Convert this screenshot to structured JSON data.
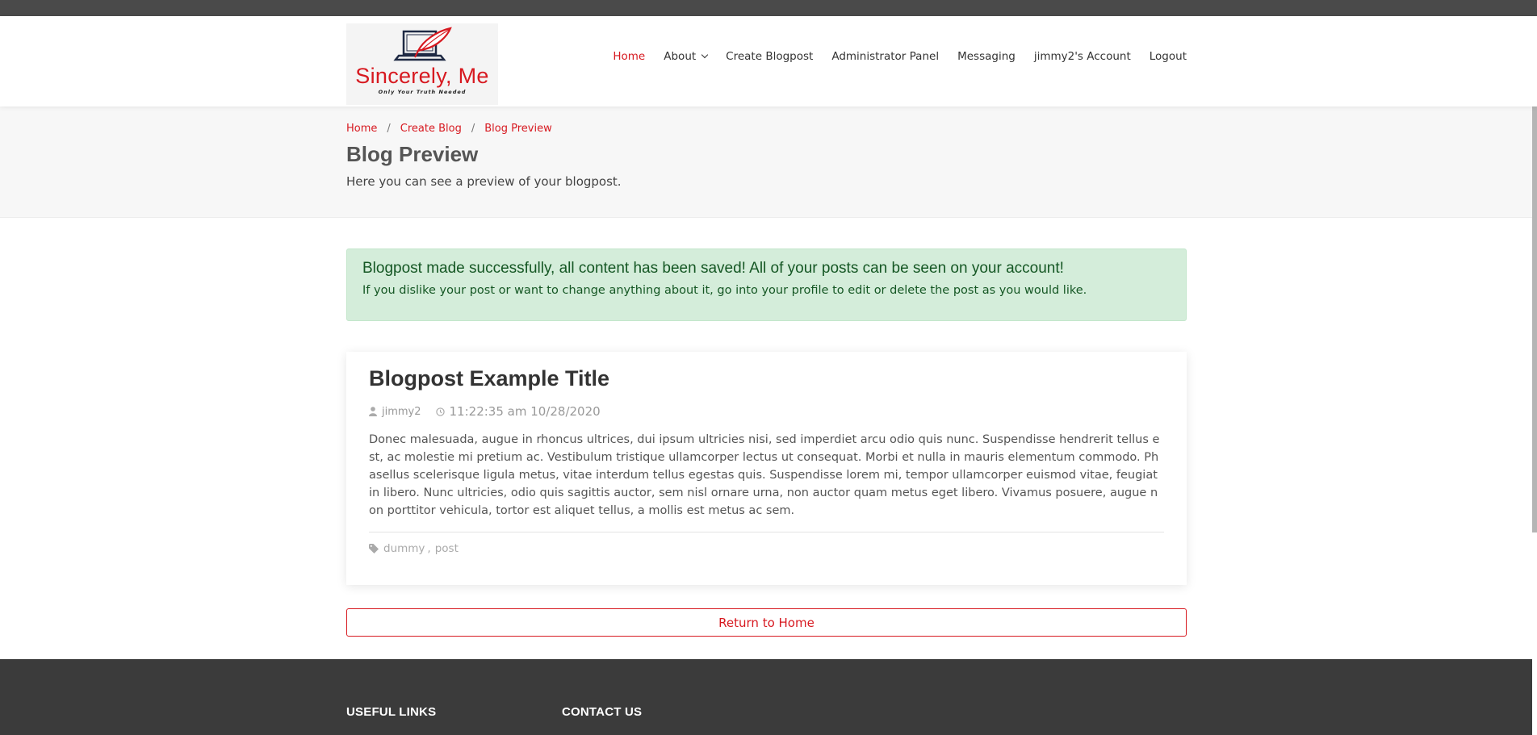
{
  "logo": {
    "name": "Sincerely, Me",
    "tagline": "Only Your Truth Needed"
  },
  "nav": {
    "items": [
      {
        "label": "Home",
        "active": true
      },
      {
        "label": "About",
        "dropdown": true
      },
      {
        "label": "Create Blogpost"
      },
      {
        "label": "Administrator Panel"
      },
      {
        "label": "Messaging"
      },
      {
        "label": "jimmy2's Account"
      },
      {
        "label": "Logout"
      }
    ]
  },
  "breadcrumb": [
    "Home",
    "Create Blog",
    "Blog Preview"
  ],
  "page": {
    "title": "Blog Preview",
    "subtitle": "Here you can see a preview of your blogpost."
  },
  "alert": {
    "heading": "Blogpost made successfully, all content has been saved! All of your posts can be seen on your account!",
    "body": "If you dislike your post or want to change anything about it, go into your profile to edit or delete the post as you would like."
  },
  "post": {
    "title": "Blogpost Example Title",
    "author": "jimmy2",
    "timestamp": "11:22:35 am 10/28/2020",
    "body": "Donec malesuada, augue in rhoncus ultrices, dui ipsum ultricies nisi, sed imperdiet arcu odio quis nunc. Suspendisse hendrerit tellus est, ac molestie mi pretium ac. Vestibulum tristique ullamcorper lectus ut consequat. Morbi et nulla in mauris elementum commodo. Phasellus scelerisque ligula metus, vitae interdum tellus egestas quis. Suspendisse lorem mi, tempor ullamcorper euismod vitae, feugiat in libero. Nunc ultricies, odio quis sagittis auctor, sem nisl ornare urna, non auctor quam metus eget libero. Vivamus posuere, augue non porttitor vehicula, tortor est aliquet tellus, a mollis est metus ac sem.",
    "tags": [
      "dummy",
      "post"
    ]
  },
  "return_button": "Return to Home",
  "footer": {
    "col1": "USEFUL LINKS",
    "col2": "CONTACT US"
  },
  "colors": {
    "accent": "#d71920",
    "success_bg": "#d4edda",
    "success_text": "#155724",
    "footer_bg": "#3b3b3b"
  }
}
